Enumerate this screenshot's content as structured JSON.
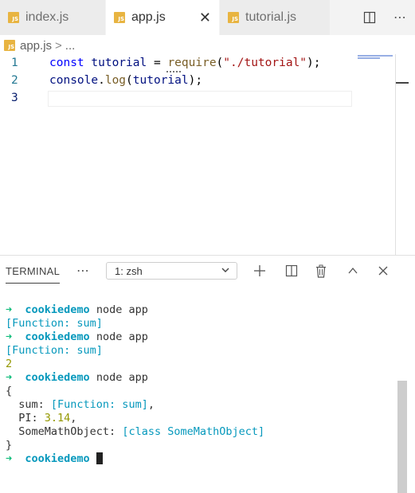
{
  "tabs": [
    {
      "label": "index.js",
      "icon": "JS",
      "active": false
    },
    {
      "label": "app.js",
      "icon": "JS",
      "active": true,
      "close": "✕"
    },
    {
      "label": "tutorial.js",
      "icon": "JS",
      "active": false
    }
  ],
  "tab_actions": {
    "split": "split-editor-icon",
    "more": "⋯"
  },
  "breadcrumb": {
    "file": "app.js",
    "separator": ">",
    "rest": "..."
  },
  "editor": {
    "line_numbers": [
      "1",
      "2",
      "3"
    ],
    "line1": {
      "kw": "const",
      "var": "tutorial",
      "eq": " = ",
      "fn": "require",
      "p1": "(",
      "str": "\"./tutorial\"",
      "p2": ");"
    },
    "line2": {
      "obj": "console",
      "dot": ".",
      "fn": "log",
      "p1": "(",
      "var": "tutorial",
      "p2": ");"
    }
  },
  "panel": {
    "title": "TERMINAL",
    "more": "⋯",
    "terminal_select": "1: zsh",
    "actions": [
      "plus-icon",
      "split-terminal-icon",
      "trash-icon",
      "chevron-up-icon",
      "close-icon"
    ]
  },
  "terminal": {
    "prompt_arrow": "➜",
    "dir": "cookiedemo",
    "cmd": "node app",
    "out_function": "[Function: sum]",
    "out_two": "2",
    "brace_open": "{",
    "sum_key": "  sum: ",
    "sum_val": "[Function: sum]",
    "pi_key": "  PI: ",
    "pi_val": "3.14",
    "obj_key": "  SomeMathObject: ",
    "obj_val": "[class SomeMathObject]",
    "brace_close": "}",
    "comma": ","
  }
}
